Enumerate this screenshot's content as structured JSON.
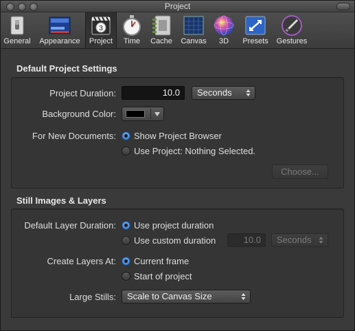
{
  "window": {
    "title": "Project"
  },
  "toolbar": {
    "items": [
      {
        "label": "General",
        "icon": "switch-icon"
      },
      {
        "label": "Appearance",
        "icon": "appearance-icon"
      },
      {
        "label": "Project",
        "icon": "clapperboard-icon",
        "selected": true
      },
      {
        "label": "Time",
        "icon": "stopwatch-icon"
      },
      {
        "label": "Cache",
        "icon": "cache-icon"
      },
      {
        "label": "Canvas",
        "icon": "canvas-grid-icon"
      },
      {
        "label": "3D",
        "icon": "sphere-icon"
      },
      {
        "label": "Presets",
        "icon": "presets-icon"
      },
      {
        "label": "Gestures",
        "icon": "pen-icon"
      }
    ]
  },
  "default_project": {
    "heading": "Default Project Settings",
    "duration_label": "Project Duration:",
    "duration_value": "10.0",
    "duration_unit": "Seconds",
    "background_label": "Background Color:",
    "background_color": "#000000",
    "new_docs_label": "For New Documents:",
    "option_browser": "Show Project Browser",
    "option_use_project": "Use Project: Nothing Selected.",
    "choose_button": "Choose..."
  },
  "still_images": {
    "heading": "Still Images & Layers",
    "layer_duration_label": "Default Layer Duration:",
    "option_project_duration": "Use project duration",
    "option_custom_duration": "Use custom duration",
    "custom_value": "10.0",
    "custom_unit": "Seconds",
    "create_at_label": "Create Layers At:",
    "option_current_frame": "Current frame",
    "option_start": "Start of project",
    "large_stills_label": "Large Stills:",
    "large_stills_value": "Scale to Canvas Size"
  },
  "colors": {
    "accent": "#3a86dd",
    "background": "#3a3a3a"
  }
}
